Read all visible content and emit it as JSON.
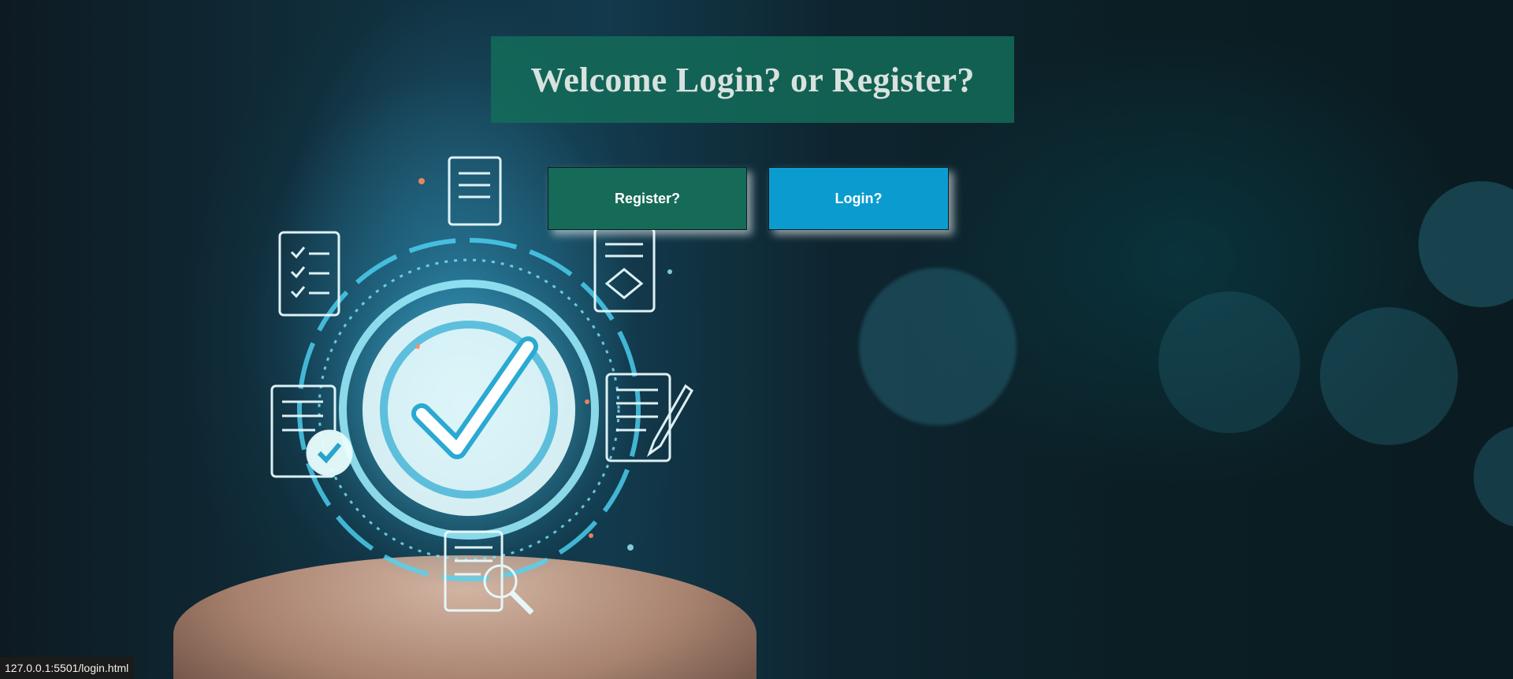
{
  "page": {
    "heading": "Welcome Login? or Register?"
  },
  "actions": {
    "register_label": "Register?",
    "login_label": "Login?"
  },
  "status_bar": {
    "url": "127.0.0.1:5501/login.html"
  },
  "colors": {
    "heading_bg": "#146e5a",
    "register_bg": "#166b58",
    "login_bg": "#0b9ccf",
    "accent_glow": "#6fe6ff"
  },
  "icons": {
    "hero": "checkmark-badge-icon",
    "docs": [
      "checklist-document-icon",
      "document-icon",
      "approved-document-icon",
      "edit-document-icon",
      "search-document-icon"
    ]
  }
}
